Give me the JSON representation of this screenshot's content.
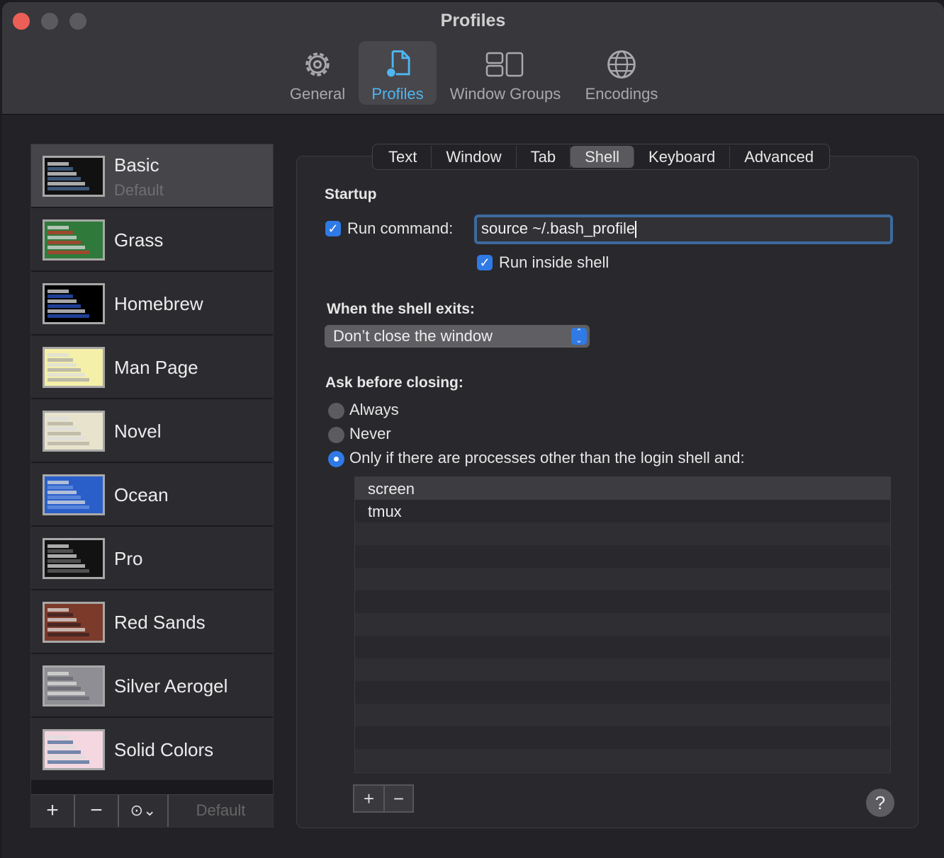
{
  "window": {
    "title": "Profiles"
  },
  "toolbar": [
    {
      "label": "General",
      "icon": "gear-icon"
    },
    {
      "label": "Profiles",
      "icon": "profile-document-icon",
      "selected": true
    },
    {
      "label": "Window Groups",
      "icon": "window-groups-icon"
    },
    {
      "label": "Encodings",
      "icon": "globe-icon"
    }
  ],
  "profiles": [
    {
      "name": "Basic",
      "subtitle": "Default",
      "bg": "#111111",
      "fg": "#4a6c9a",
      "selected": true
    },
    {
      "name": "Grass",
      "bg": "#2f7a3b",
      "fg": "#c0392b"
    },
    {
      "name": "Homebrew",
      "bg": "#000000",
      "fg": "#2a55c8"
    },
    {
      "name": "Man Page",
      "bg": "#f5f0a9",
      "fg": "#aaaaaa"
    },
    {
      "name": "Novel",
      "bg": "#e8e3cc",
      "fg": "#b5b0a0"
    },
    {
      "name": "Ocean",
      "bg": "#2a5fc9",
      "fg": "#6a90e0"
    },
    {
      "name": "Pro",
      "bg": "#121212",
      "fg": "#666666"
    },
    {
      "name": "Red Sands",
      "bg": "#7b3a2a",
      "fg": "#3a2020"
    },
    {
      "name": "Silver Aerogel",
      "bg": "#8e8e94",
      "fg": "#666670"
    },
    {
      "name": "Solid Colors",
      "bg": "#f4d7e0",
      "fg": "#4a6c9a"
    }
  ],
  "sidebar_footer": {
    "add": "+",
    "remove": "−",
    "more_icon": "ellipsis-circle-icon",
    "default_label": "Default"
  },
  "tabs": [
    "Text",
    "Window",
    "Tab",
    "Shell",
    "Keyboard",
    "Advanced"
  ],
  "selected_tab": "Shell",
  "shell": {
    "startup_heading": "Startup",
    "run_command_label": "Run command:",
    "run_command_checked": true,
    "run_command_value": "source ~/.bash_profile",
    "run_inside_shell_label": "Run inside shell",
    "run_inside_shell_checked": true,
    "exit_heading": "When the shell exits:",
    "exit_option": "Don’t close the window",
    "ask_heading": "Ask before closing:",
    "ask_options": [
      "Always",
      "Never",
      "Only if there are processes other than the login shell and:"
    ],
    "ask_selected": 2,
    "processes": [
      "screen",
      "tmux"
    ],
    "add": "+",
    "remove": "−",
    "help": "?"
  },
  "colors": {
    "accent": "#2f7ae5",
    "selected_toolbar": "#4fb6f2",
    "close": "#ec5f57"
  }
}
